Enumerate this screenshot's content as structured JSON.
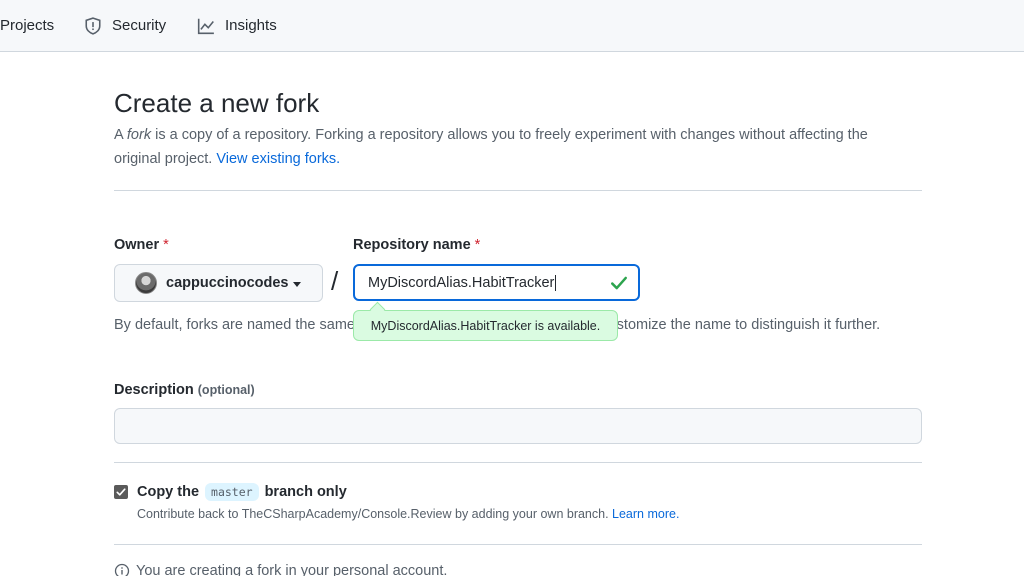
{
  "nav": {
    "items": [
      {
        "label": "Projects",
        "icon": "projects-icon"
      },
      {
        "label": "Security",
        "icon": "shield-icon"
      },
      {
        "label": "Insights",
        "icon": "graph-icon"
      }
    ]
  },
  "page": {
    "title": "Create a new fork",
    "subtitle_prefix": "A ",
    "subtitle_em": "fork",
    "subtitle_text": " is a copy of a repository. Forking a repository allows you to freely experiment with changes without affecting the original project. ",
    "subtitle_link": "View existing forks."
  },
  "form": {
    "owner_label": "Owner",
    "owner_required": "*",
    "owner_value": "cappuccinocodes",
    "slash": "/",
    "repo_label": "Repository name",
    "repo_required": "*",
    "repo_value": "MyDiscordAlias.HabitTracker",
    "availability": "MyDiscordAlias.HabitTracker is available.",
    "helper_text": "By default, forks are named the same as their upstream repository. You can customize the name to distinguish it further.",
    "description_label": "Description",
    "description_optional": "(optional)",
    "description_value": "",
    "copy_prefix": "Copy the",
    "copy_branch": "master",
    "copy_suffix": "branch only",
    "copy_checked": true,
    "contrib_text": "Contribute back to TheCSharpAcademy/Console.Review by adding your own branch. ",
    "contrib_link": "Learn more.",
    "info_text": "You are creating a fork in your personal account."
  },
  "colors": {
    "accent": "#0969da",
    "success": "#1a7f37",
    "danger": "#cf222e"
  }
}
